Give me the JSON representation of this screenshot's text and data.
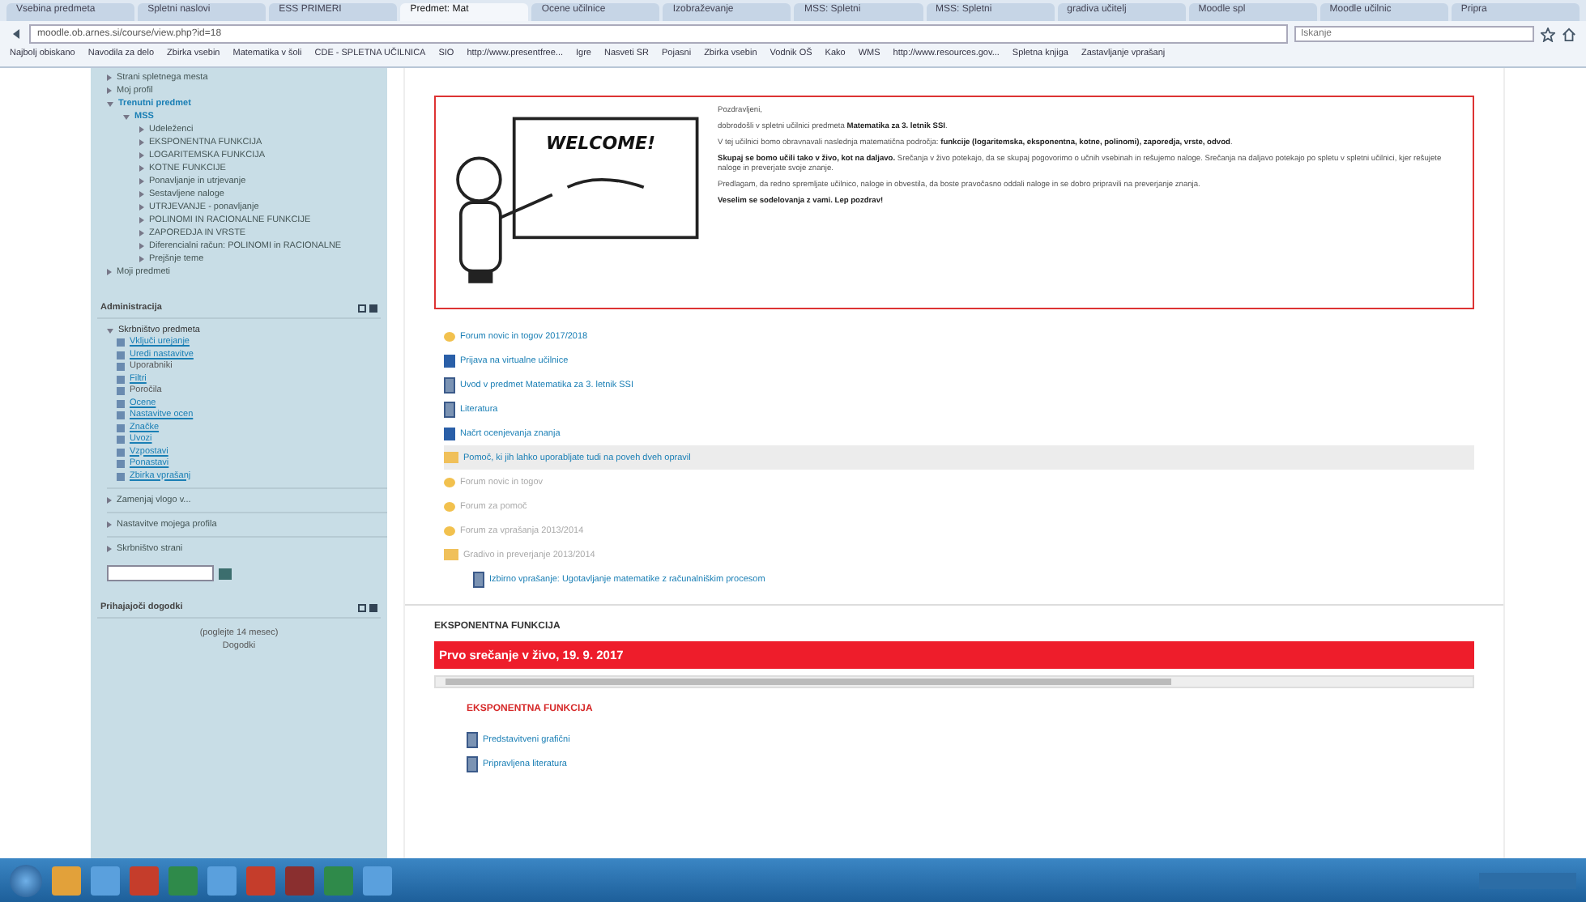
{
  "browser": {
    "tabs": [
      {
        "label": "Vsebina predmeta",
        "selected": false
      },
      {
        "label": "Spletni naslovi",
        "selected": false
      },
      {
        "label": "ESS PRIMERI",
        "selected": false
      },
      {
        "label": "Predmet: Mat",
        "selected": true
      },
      {
        "label": "Ocene učilnice",
        "selected": false
      },
      {
        "label": "Izobraževanje",
        "selected": false
      },
      {
        "label": "MSS: Spletni",
        "selected": false
      },
      {
        "label": "MSS: Spletni",
        "selected": false
      },
      {
        "label": "gradiva učitelj",
        "selected": false
      },
      {
        "label": "Moodle spl",
        "selected": false
      },
      {
        "label": "Moodle učilnic",
        "selected": false
      },
      {
        "label": "Pripra",
        "selected": false
      }
    ],
    "address": "moodle.ob.arnes.si/course/view.php?id=18",
    "search_placeholder": "Iskanje",
    "bookmarks": [
      "Najbolj obiskano",
      "Navodila za delo",
      "Zbirka vsebin",
      "Matematika v šoli",
      "CDE - SPLETNA UČILNICA",
      "SIO",
      "http://www.presentfree...",
      "Igre",
      "Nasveti SR",
      "Pojasni",
      "Zbirka vsebin",
      "Vodnik OŠ",
      "Kako",
      "WMS",
      "http://www.resources.gov...",
      "Spletna knjiga",
      "Zastavljanje vprašanj"
    ]
  },
  "navigation": [
    {
      "label": "Strani spletnega mesta",
      "expanded": false
    },
    {
      "label": "Moj profil",
      "expanded": false
    },
    {
      "label": "Trenutni predmet",
      "expanded": true,
      "children": [
        {
          "label": "MSS",
          "expanded": true,
          "children": [
            {
              "label": "Udeleženci",
              "expanded": false
            },
            {
              "label": "EKSPONENTNA FUNKCIJA",
              "expanded": false
            },
            {
              "label": "LOGARITEMSKA FUNKCIJA",
              "expanded": false
            },
            {
              "label": "KOTNE FUNKCIJE",
              "expanded": false
            },
            {
              "label": "Ponavljanje in utrjevanje",
              "expanded": false
            },
            {
              "label": "Sestavljene naloge",
              "expanded": false
            },
            {
              "label": "UTRJEVANJE - ponavljanje",
              "expanded": false
            },
            {
              "label": "POLINOMI IN RACIONALNE FUNKCIJE",
              "expanded": false
            },
            {
              "label": "ZAPOREDJA IN VRSTE",
              "expanded": false
            },
            {
              "label": "Diferencialni račun: POLINOMI in RACIONALNE",
              "expanded": false
            },
            {
              "label": "Prejšnje teme",
              "expanded": false
            }
          ]
        }
      ]
    },
    {
      "label": "Moji predmeti",
      "expanded": false
    }
  ],
  "administration": {
    "title": "Administracija",
    "section": "Skrbništvo predmeta",
    "items": [
      {
        "label": "Vključi urejanje",
        "link": true
      },
      {
        "label": "Uredi nastavitve",
        "link": true
      },
      {
        "label": "Uporabniki",
        "link": false
      },
      {
        "label": "Filtri",
        "link": true
      },
      {
        "label": "Poročila",
        "link": false
      },
      {
        "label": "Ocene",
        "link": true
      },
      {
        "label": "Nastavitve ocen",
        "link": true
      },
      {
        "label": "Značke",
        "link": true
      },
      {
        "label": "Uvozi",
        "link": true
      },
      {
        "label": "Vzpostavi",
        "link": true
      },
      {
        "label": "Ponastavi",
        "link": true
      },
      {
        "label": "Zbirka vprašanj",
        "link": true
      }
    ],
    "collapsed": [
      "Zamenjaj vlogo v...",
      "Nastavitve mojega profila",
      "Skrbništvo strani"
    ]
  },
  "events": {
    "title": "Prihajajoči dogodki",
    "lines": [
      "(poglejte 14 mesec)",
      "Dogodki"
    ]
  },
  "welcome": {
    "board": "WELCOME!",
    "paragraphs": [
      "Pozdravljeni,",
      "dobrodošli v spletni učilnici predmeta **Matematika za 3. letnik SSI**.",
      "V tej učilnici bomo obravnavali naslednja matematična področja: **funkcije (logaritemska, eksponentna, kotne, polinomi), zaporedja, vrste, odvod**.",
      "**Skupaj se bomo učili tako v živo, kot na daljavo.** Srečanja v živo potekajo, da se skupaj pogovorimo o učnih vsebinah in rešujemo naloge. Srečanja na daljavo potekajo po spletu v spletni učilnici, kjer rešujete naloge in preverjate svoje znanje.",
      "Predlagam, da redno spremljate učilnico, naloge in obvestila, da boste pravočasno oddali naloge in se dobro pripravili na preverjanje znanja.",
      "**Veselim se sodelovanja z vami. Lep pozdrav!**"
    ]
  },
  "activities": [
    {
      "kind": "forum",
      "label": "Forum novic in togov 2017/2018",
      "hidden": false,
      "selected": false,
      "indent": false
    },
    {
      "kind": "page",
      "label": "Prijava na virtualne učilnice",
      "hidden": false,
      "selected": false,
      "indent": false
    },
    {
      "kind": "file",
      "label": "Uvod v predmet Matematika za 3. letnik SSI",
      "hidden": false,
      "selected": false,
      "indent": false
    },
    {
      "kind": "file",
      "label": "Literatura",
      "hidden": false,
      "selected": false,
      "indent": false
    },
    {
      "kind": "page",
      "label": "Načrt ocenjevanja znanja",
      "hidden": false,
      "selected": false,
      "indent": false
    },
    {
      "kind": "folder",
      "label": "Pomoč, ki jih lahko uporabljate tudi na poveh dveh opravil",
      "hidden": false,
      "selected": true,
      "indent": false
    },
    {
      "kind": "forum",
      "label": "Forum novic in togov",
      "hidden": true,
      "selected": false,
      "indent": false
    },
    {
      "kind": "forum",
      "label": "Forum za pomoč",
      "hidden": true,
      "selected": false,
      "indent": false
    },
    {
      "kind": "forum",
      "label": "Forum za vprašanja 2013/2014",
      "hidden": true,
      "selected": false,
      "indent": false
    },
    {
      "kind": "folder",
      "label": "Gradivo in preverjanje 2013/2014",
      "hidden": true,
      "selected": false,
      "indent": false
    },
    {
      "kind": "file",
      "label": "Izbirno vprašanje: Ugotavljanje matematike z računalniškim procesom",
      "hidden": false,
      "selected": false,
      "indent": true
    }
  ],
  "section": {
    "title": "EKSPONENTNA FUNKCIJA",
    "banner": "Prvo srečanje v živo, 19. 9. 2017",
    "subtitle": "EKSPONENTNA FUNKCIJA",
    "items": [
      {
        "kind": "file",
        "label": "Predstavitveni grafični"
      },
      {
        "kind": "file",
        "label": "Pripravljena literatura"
      }
    ]
  }
}
